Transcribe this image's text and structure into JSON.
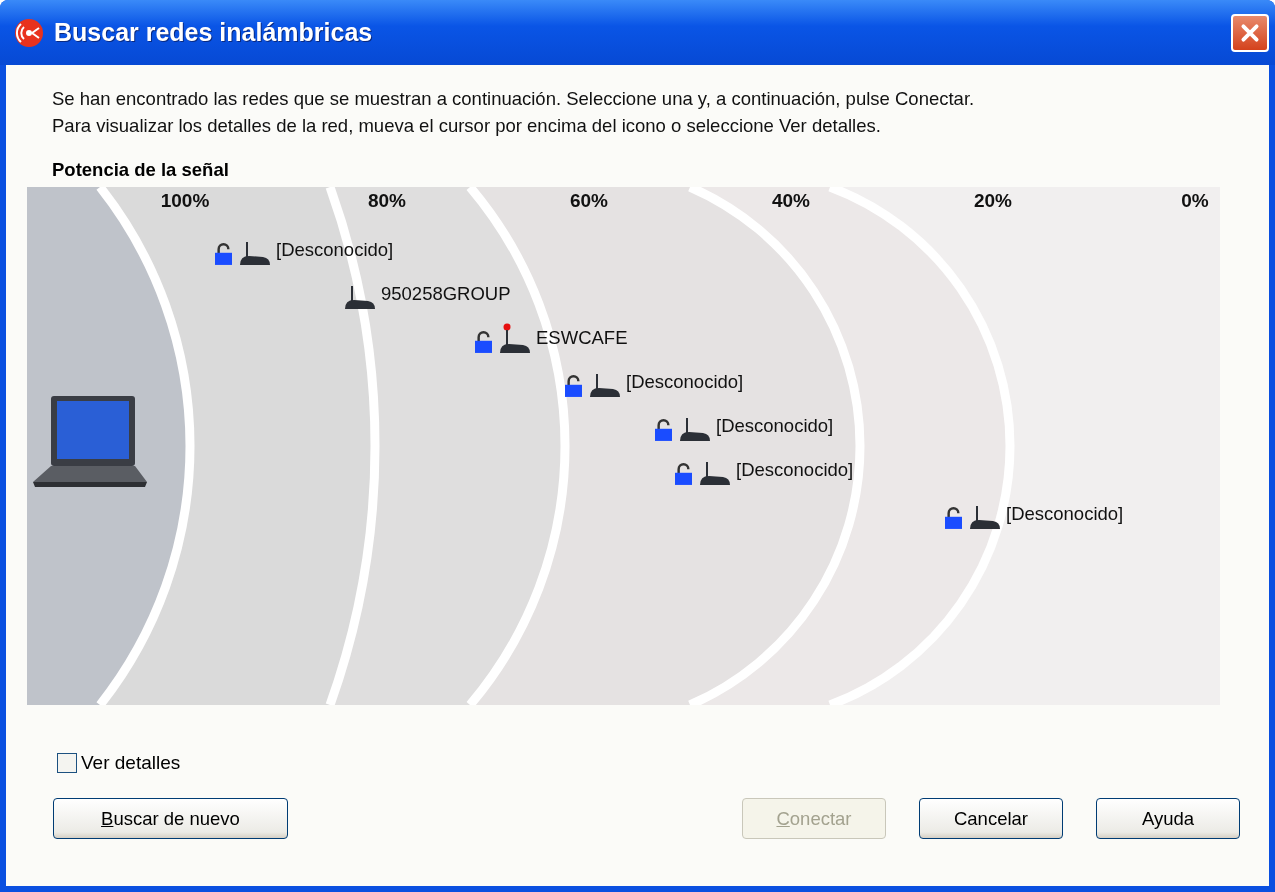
{
  "window": {
    "title": "Buscar redes inalámbricas"
  },
  "intro": [
    "Se han encontrado las redes que se muestran a continuación. Seleccione una y, a continuación, pulse Conectar.",
    "Para visualizar los detalles de la red, mueva el cursor por encima del icono o seleccione Ver detalles."
  ],
  "signal": {
    "heading": "Potencia de la señal",
    "scale": [
      "100%",
      "80%",
      "60%",
      "40%",
      "20%",
      "0%"
    ],
    "networks": [
      {
        "name": "[Desconocido]",
        "secured": true,
        "connected": false
      },
      {
        "name": "950258GROUP",
        "secured": false,
        "connected": false
      },
      {
        "name": "ESWCAFE",
        "secured": true,
        "connected": true
      },
      {
        "name": "[Desconocido]",
        "secured": true,
        "connected": false
      },
      {
        "name": "[Desconocido]",
        "secured": true,
        "connected": false
      },
      {
        "name": "[Desconocido]",
        "secured": true,
        "connected": false
      },
      {
        "name": "[Desconocido]",
        "secured": true,
        "connected": false
      }
    ]
  },
  "details_checkbox": {
    "label": "Ver detalles",
    "checked": false
  },
  "buttons": [
    {
      "label": "Buscar de nuevo",
      "disabled": false,
      "accel": true
    },
    {
      "label": "Conectar",
      "disabled": true,
      "accel": true
    },
    {
      "label": "Cancelar",
      "disabled": false,
      "accel": false
    },
    {
      "label": "Ayuda",
      "disabled": false,
      "accel": false
    }
  ]
}
